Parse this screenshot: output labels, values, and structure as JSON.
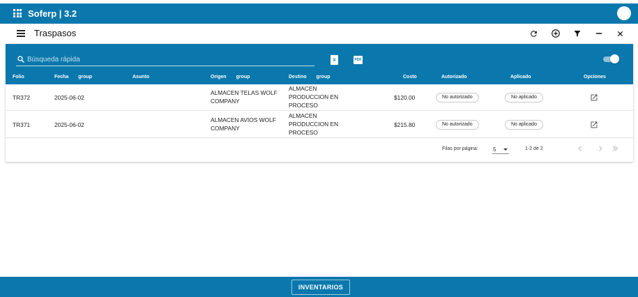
{
  "app": {
    "title": "Soferp | 3.2"
  },
  "page": {
    "title": "Traspasos"
  },
  "colors": {
    "primary": "#0a78ad",
    "background": "#ffffff"
  },
  "toolbar_icons": [
    "refresh-icon",
    "add-circle-icon",
    "filter-icon",
    "minimize-icon",
    "close-icon"
  ],
  "search": {
    "placeholder": "Búsqueda rápida",
    "value": ""
  },
  "export": {
    "excel_label": "X",
    "pdf_label": "PDF"
  },
  "toggle": {
    "on": true
  },
  "table": {
    "headers": {
      "folio": "Folio",
      "fecha": "Fecha",
      "fecha_group": "group",
      "asunto": "Asunto",
      "origen": "Origen",
      "origen_group": "group",
      "destino": "Destino",
      "destino_group": "group",
      "costo": "Costo",
      "autorizado": "Autorizado",
      "aplicado": "Aplicado",
      "opciones": "Opciones"
    },
    "rows": [
      {
        "folio": "TR372",
        "fecha": "2025-06-02",
        "asunto": "",
        "origen": "ALMACEN TELAS WOLF COMPANY",
        "destino": "ALMACEN PRODUCCION EN PROCESO",
        "costo": "$120.00",
        "autorizado": "No autorizado",
        "aplicado": "No aplicado"
      },
      {
        "folio": "TR371",
        "fecha": "2025-06-02",
        "asunto": "",
        "origen": "ALMACEN AVIOS WOLF COMPANY",
        "destino": "ALMACEN PRODUCCION EN PROCESO",
        "costo": "$215.80",
        "autorizado": "No autorizado",
        "aplicado": "No aplicado"
      }
    ]
  },
  "pagination": {
    "rows_per_page_label": "Filas por página:",
    "rows_per_page": "5",
    "range": "1-2 de 2"
  },
  "footer": {
    "button_label": "INVENTARIOS"
  }
}
